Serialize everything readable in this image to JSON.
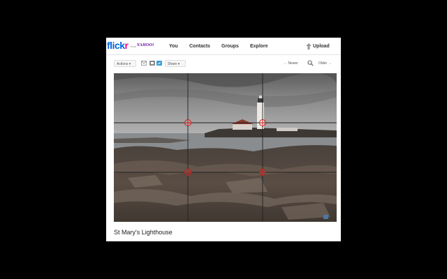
{
  "header": {
    "logo_flick": "flick",
    "logo_r": "r",
    "logo_from": "from",
    "logo_yahoo": "YAHOO!",
    "nav": [
      {
        "label": "You"
      },
      {
        "label": "Contacts"
      },
      {
        "label": "Groups"
      },
      {
        "label": "Explore"
      }
    ],
    "upload_label": "Upload",
    "upload_icon": "upload-arrow-icon"
  },
  "toolbar": {
    "actions_label": "Actions ▾",
    "share_label": "Share ▾",
    "newer_label": "← Newer",
    "older_label": "Older →",
    "share_icons": [
      "mail-icon",
      "blogger-icon",
      "twitter-icon"
    ],
    "zoom_icon": "magnifier-icon"
  },
  "photo": {
    "caption": "St Mary's Lighthouse",
    "overlay": "rule-of-thirds grid with intersection markers",
    "marker_color": "#cc1f1f",
    "grid_color": "#222222"
  },
  "colors": {
    "flickr_blue": "#0063dc",
    "flickr_pink": "#ff0084",
    "yahoo_purple": "#6a0f9d",
    "background": "#000000"
  }
}
